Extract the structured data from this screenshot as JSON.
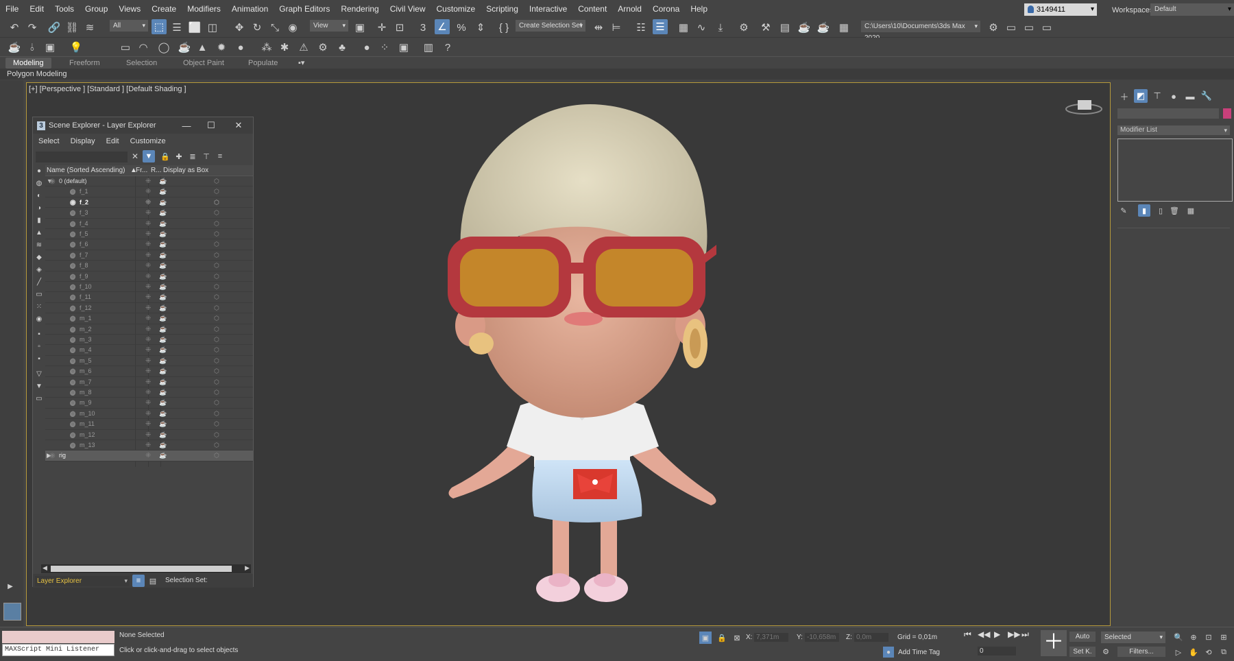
{
  "menu": [
    "File",
    "Edit",
    "Tools",
    "Group",
    "Views",
    "Create",
    "Modifiers",
    "Animation",
    "Graph Editors",
    "Rendering",
    "Civil View",
    "Customize",
    "Scripting",
    "Interactive",
    "Content",
    "Arnold",
    "Corona",
    "Help"
  ],
  "user": "3149411",
  "workspaces_label": "Workspaces:",
  "workspace": "Default",
  "toolbar": {
    "filter": "All",
    "ref_coord": "View",
    "selection_set": "Create Selection Set",
    "project_path": "C:\\Users\\10\\Documents\\3ds Max 2020"
  },
  "ribbon_tabs": [
    "Modeling",
    "Freeform",
    "Selection",
    "Object Paint",
    "Populate"
  ],
  "ribbon_sub": "Polygon Modeling",
  "viewport_label": "[+] [Perspective ] [Standard ] [Default Shading ]",
  "scene_explorer": {
    "title": "Scene Explorer - Layer Explorer",
    "menu": [
      "Select",
      "Display",
      "Edit",
      "Customize"
    ],
    "col_name": "Name (Sorted Ascending)",
    "col_freeze": "Fr...",
    "col_render": "R...",
    "col_box": "Display as Box",
    "default_layer": "0 (default)",
    "items": [
      "f_1",
      "f_2",
      "f_3",
      "f_4",
      "f_5",
      "f_6",
      "f_7",
      "f_8",
      "f_9",
      "f_10",
      "f_11",
      "f_12",
      "m_1",
      "m_2",
      "m_3",
      "m_4",
      "m_5",
      "m_6",
      "m_7",
      "m_8",
      "m_9",
      "m_10",
      "m_11",
      "m_12",
      "m_13"
    ],
    "rig_layer": "rig",
    "explorer_type": "Layer Explorer",
    "selection_set_label": "Selection Set:"
  },
  "command_panel": {
    "modifier_list": "Modifier List"
  },
  "status": {
    "maxscript": "MAXScript Mini Listener",
    "selected": "None Selected",
    "prompt": "Click or click-and-drag to select objects",
    "x_label": "X:",
    "x": "7,371m",
    "y_label": "Y:",
    "y": "-10,658m",
    "z_label": "Z:",
    "z": "0,0m",
    "grid": "Grid = 0,01m",
    "add_time_tag": "Add Time Tag",
    "auto": "Auto",
    "set_key": "Set K.",
    "key_mode": "Selected",
    "frame": "0",
    "filters": "Filters..."
  },
  "colors": {
    "accent": "#5b86b8",
    "viewport_border": "#b79a3b",
    "layer_combo": "#e6c243"
  }
}
